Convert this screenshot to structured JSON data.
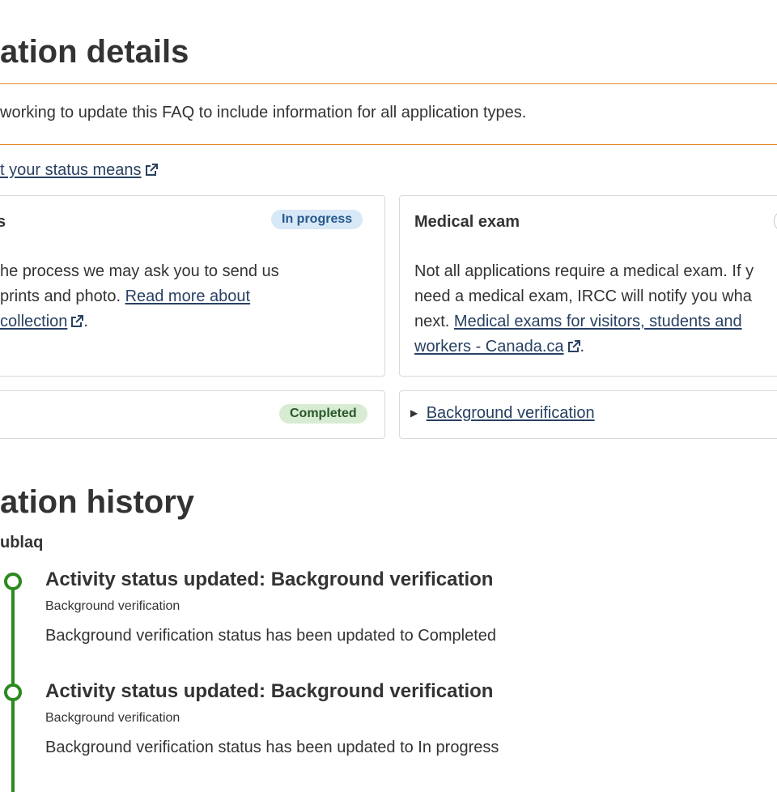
{
  "details": {
    "heading": "ation details",
    "notice": "working to update this FAQ to include information for all application types.",
    "status_link": "t your status means"
  },
  "cards": {
    "biometrics": {
      "title": "s",
      "badge": "In progress",
      "line1": "he process we may ask you to send us",
      "line2_text": "prints and photo. ",
      "line2_link": "Read more about",
      "line3_link": "collection",
      "line3_tail": "."
    },
    "medical": {
      "title": "Medical exam",
      "line1": "Not all applications require a medical exam. If y",
      "line2": "need a medical exam, IRCC will notify you wha",
      "line3_text": "next. ",
      "line3_link": "Medical exams for visitors, students and",
      "line4_link": "workers - Canada.ca",
      "line4_tail": "."
    },
    "completed_card": {
      "badge": "Completed"
    },
    "background": {
      "toggle_icon": "▶",
      "label": "Background verification"
    }
  },
  "history": {
    "heading": "ation history",
    "subheading": "ublaq",
    "events": [
      {
        "title": "Activity status updated: Background verification",
        "subtitle": "Background verification",
        "description": "Background verification status has been updated to Completed"
      },
      {
        "title": "Activity status updated: Background verification",
        "subtitle": "Background verification",
        "description": "Background verification status has been updated to In progress"
      }
    ]
  },
  "colors": {
    "notice_border": "#e6872c",
    "link": "#284162",
    "timeline": "#2b8a1e",
    "badge_in_progress_bg": "#d7e8f7",
    "badge_completed_bg": "#d8ecd3"
  },
  "icons": {
    "external_link": "external-link-icon"
  }
}
